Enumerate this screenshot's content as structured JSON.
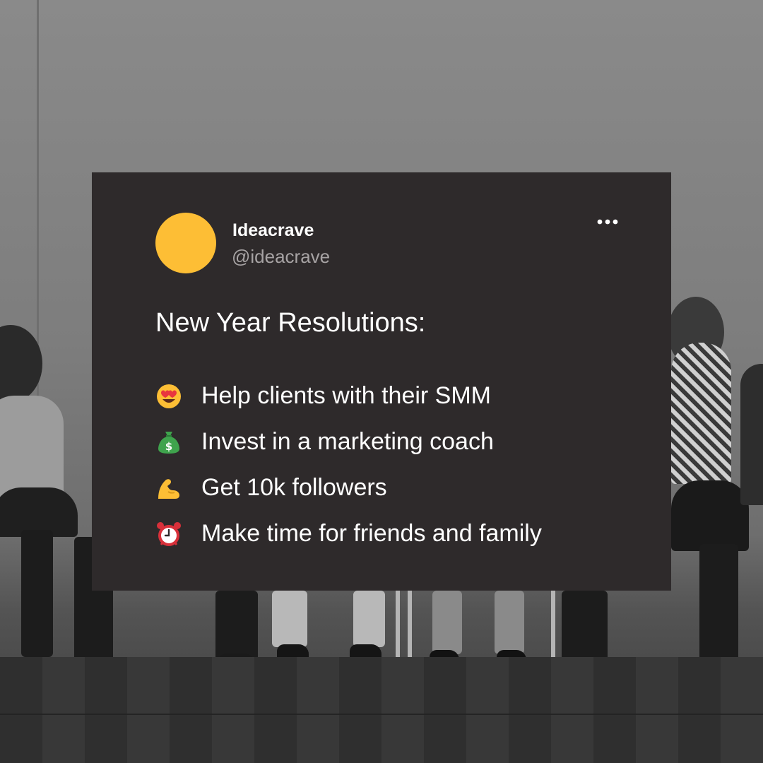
{
  "post": {
    "author_name": "Ideacrave",
    "author_handle": "@ideacrave",
    "title": "New Year Resolutions:",
    "items": [
      {
        "icon": "heart-eyes-emoji-icon",
        "text": "Help clients with their SMM"
      },
      {
        "icon": "money-bag-emoji-icon",
        "text": "Invest in a marketing coach"
      },
      {
        "icon": "flexed-biceps-emoji-icon",
        "text": "Get 10k followers"
      },
      {
        "icon": "alarm-clock-emoji-icon",
        "text": "Make time for friends and family"
      }
    ]
  },
  "icons": {
    "menu": "more-options-icon"
  },
  "colors": {
    "card_background": "#2e2a2b",
    "avatar": "#fdbe35",
    "text_primary": "#ffffff",
    "text_secondary": "#a7a3a4"
  }
}
